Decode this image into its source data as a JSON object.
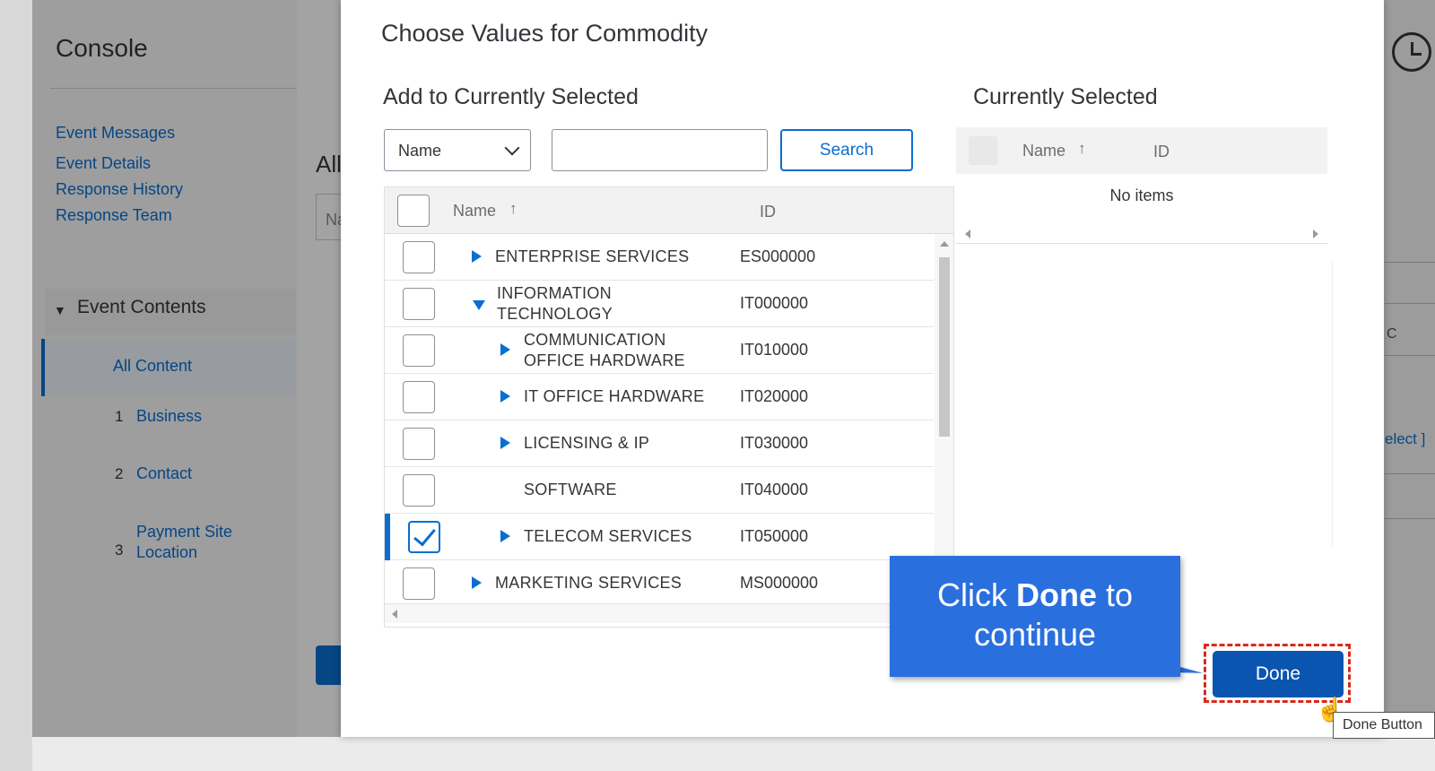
{
  "background": {
    "console_title": "Console",
    "nav_links": [
      "Event Messages",
      "Event Details",
      "Response History",
      "Response Team"
    ],
    "event_contents": "Event Contents",
    "all_content": "All Content",
    "sections": [
      {
        "num": "1",
        "label": "Business"
      },
      {
        "num": "2",
        "label": "Contact"
      },
      {
        "num": "3",
        "label": "Payment Site Location"
      }
    ],
    "mid_title": "All",
    "mid_input": "Na",
    "right_link": "elect ]",
    "right_c": "C"
  },
  "dialog": {
    "title": "Choose Values for Commodity",
    "add_heading": "Add to Currently Selected",
    "current_heading": "Currently Selected",
    "select_value": "Name",
    "search_value": "",
    "search_label": "Search",
    "columns": {
      "name": "Name",
      "id": "ID"
    },
    "rows": [
      {
        "name": "ENTERPRISE SERVICES",
        "id": "ES000000",
        "level": 0,
        "expander": "collapsed",
        "checked": false
      },
      {
        "name": "INFORMATION TECHNOLOGY",
        "id": "IT000000",
        "level": 0,
        "expander": "expanded",
        "checked": false
      },
      {
        "name": "COMMUNICATION OFFICE HARDWARE",
        "id": "IT010000",
        "level": 1,
        "expander": "collapsed",
        "checked": false
      },
      {
        "name": "IT OFFICE HARDWARE",
        "id": "IT020000",
        "level": 1,
        "expander": "collapsed",
        "checked": false
      },
      {
        "name": "LICENSING & IP",
        "id": "IT030000",
        "level": 1,
        "expander": "collapsed",
        "checked": false
      },
      {
        "name": "SOFTWARE",
        "id": "IT040000",
        "level": 1,
        "expander": "none",
        "checked": false
      },
      {
        "name": "TELECOM SERVICES",
        "id": "IT050000",
        "level": 1,
        "expander": "collapsed",
        "checked": true
      },
      {
        "name": "MARKETING SERVICES",
        "id": "MS000000",
        "level": 0,
        "expander": "collapsed",
        "checked": false
      }
    ],
    "current_columns": {
      "name": "Name",
      "id": "ID"
    },
    "no_items": "No items",
    "done_label": "Done"
  },
  "callout": {
    "pre": "Click ",
    "bold": "Done",
    "post": " to continue"
  },
  "tooltip": "Done Button",
  "colors": {
    "accent": "#0a6ed1",
    "done": "#0a55b0",
    "callout": "#2a6fde",
    "highlight": "#d92a1a"
  }
}
